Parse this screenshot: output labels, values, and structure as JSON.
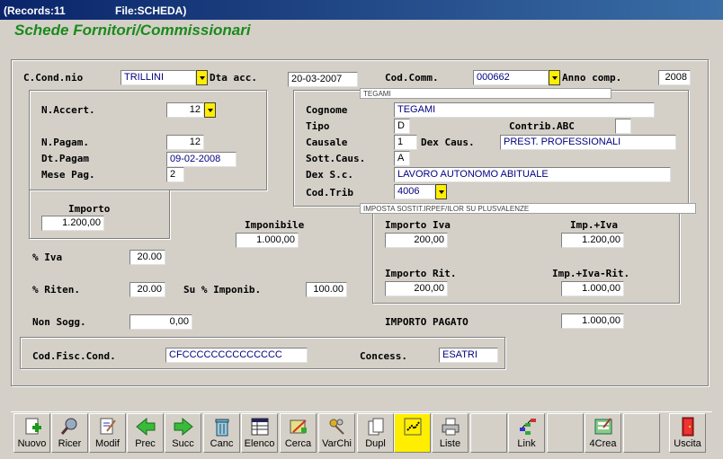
{
  "titlebar": {
    "records": "(Records:11",
    "file": "File:SCHEDA)"
  },
  "app_title": "Schede Fornitori/Commissionari",
  "header": {
    "cond_label": "C.Cond.nio",
    "cond_value": "TRILLINI",
    "dta_label": "Dta acc.",
    "dta_value": "20-03-2007",
    "codcomm_label": "Cod.Comm.",
    "codcomm_value": "000662",
    "annocomp_label": "Anno comp.",
    "annocomp_value": "2008",
    "hint_tegami": "TEGAMI"
  },
  "left": {
    "naccert_label": "N.Accert.",
    "naccert_value": "12",
    "npagam_label": "N.Pagam.",
    "npagam_value": "12",
    "dtpagam_label": "Dt.Pagam",
    "dtpagam_value": "09-02-2008",
    "mesepag_label": "Mese Pag.",
    "mesepag_value": "2",
    "importo_label": "Importo",
    "importo_value": "1.200,00"
  },
  "right": {
    "cognome_label": "Cognome",
    "cognome_value": "TEGAMI",
    "tipo_label": "Tipo",
    "tipo_value": "D",
    "contrib_label": "Contrib.ABC",
    "contrib_value": "",
    "causale_label": "Causale",
    "causale_value": "1",
    "dexcaus_label": "Dex Caus.",
    "dexcaus_value": "PREST. PROFESSIONALI",
    "sottcaus_label": "Sott.Caus.",
    "sottcaus_value": "A",
    "dexsc_label": "Dex S.c.",
    "dexsc_value": "LAVORO AUTONOMO ABITUALE",
    "codtrib_label": "Cod.Trib",
    "codtrib_value": "4006",
    "hint_trib": "IMPOSTA SOSTIT.IRPEF/ILOR SU PLUSVALENZE"
  },
  "calc": {
    "imponibile_label": "Imponibile",
    "imponibile_value": "1.000,00",
    "iva_label": "% Iva",
    "iva_value": "20.00",
    "riten_label": "% Riten.",
    "riten_value": "20.00",
    "suimp_label": "Su % Imponib.",
    "suimp_value": "100.00",
    "nonsogg_label": "Non Sogg.",
    "nonsogg_value": "0,00",
    "importoiva_label": "Importo Iva",
    "importoiva_value": "200,00",
    "impiva_label": "Imp.+Iva",
    "impiva_value": "1.200,00",
    "importorit_label": "Importo Rit.",
    "importorit_value": "200,00",
    "impivarit_label": "Imp.+Iva-Rit.",
    "impivarit_value": "1.000,00",
    "pagato_label": "IMPORTO PAGATO",
    "pagato_value": "1.000,00"
  },
  "footer": {
    "codfisc_label": "Cod.Fisc.Cond.",
    "codfisc_value": "CFCCCCCCCCCCCCCC",
    "concess_label": "Concess.",
    "concess_value": "ESATRI"
  },
  "toolbar": {
    "nuovo": "Nuovo",
    "ricer": "Ricer",
    "modif": "Modif",
    "prec": "Prec",
    "succ": "Succ",
    "canc": "Canc",
    "elenco": "Elenco",
    "cerca": "Cerca",
    "varchi": "VarChi",
    "dupl": "Dupl",
    "liste": "Liste",
    "link": "Link",
    "crea": "4Crea",
    "uscita": "Uscita"
  }
}
